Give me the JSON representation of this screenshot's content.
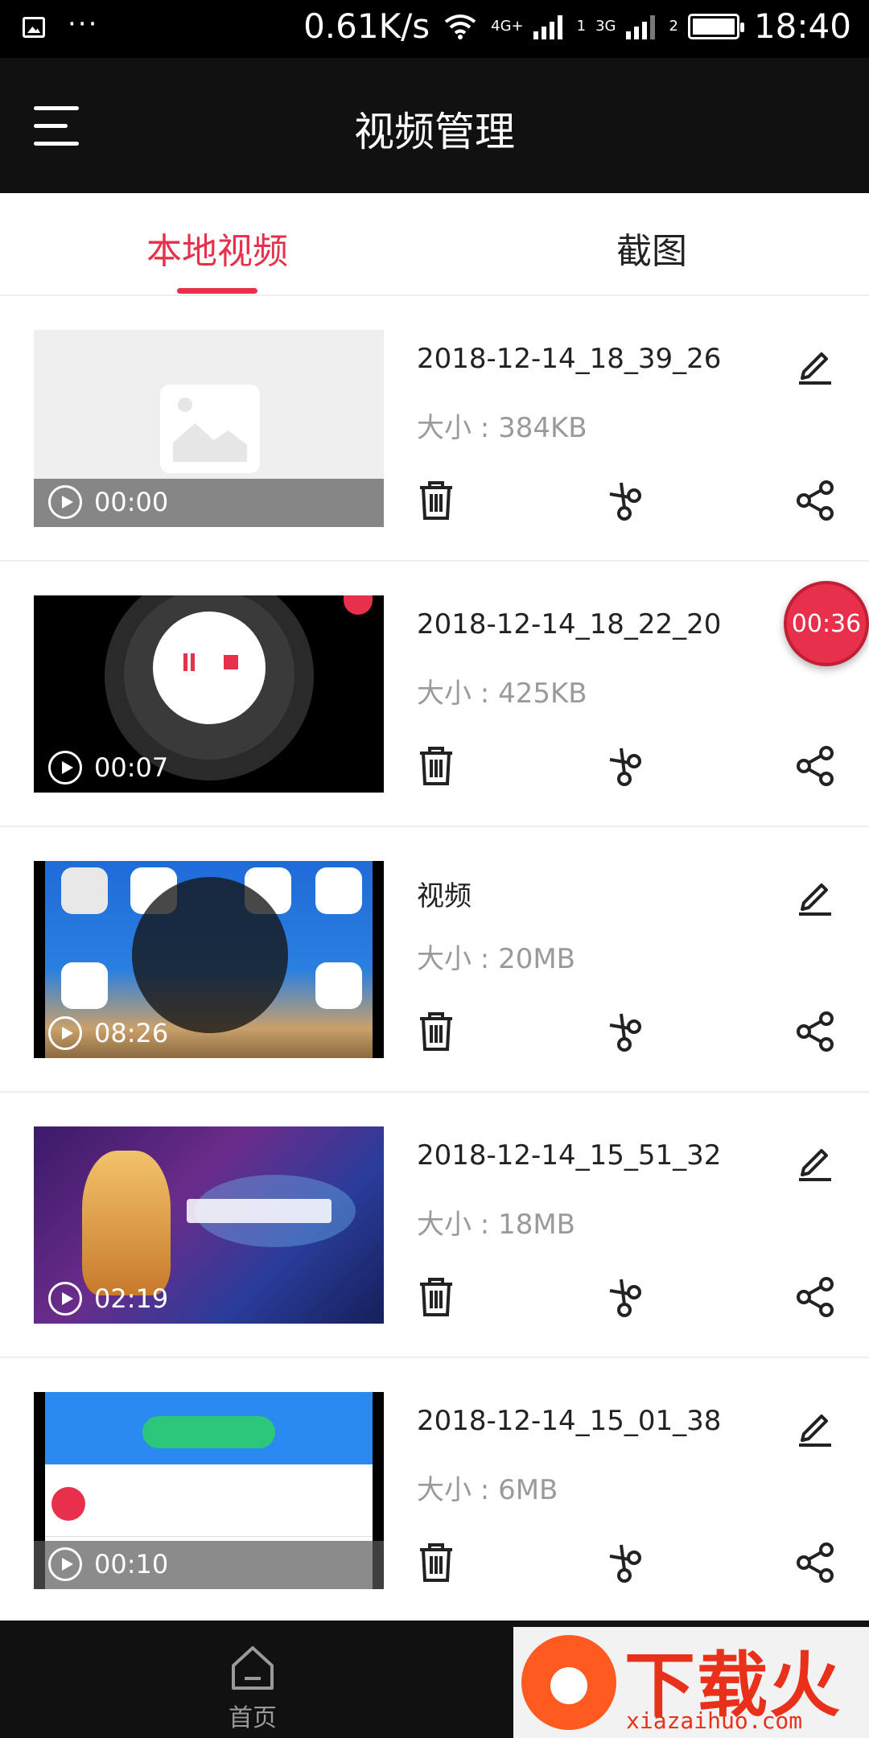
{
  "status_bar": {
    "net_speed": "0.61K/s",
    "sim1_label": "4G+",
    "sim1_slot": "1",
    "sim2_label": "3G",
    "sim2_slot": "2",
    "time": "18:40",
    "more": "···"
  },
  "app_bar": {
    "title": "视频管理"
  },
  "tabs": [
    {
      "label": "本地视频",
      "active": true
    },
    {
      "label": "截图",
      "active": false
    }
  ],
  "videos": [
    {
      "name": "2018-12-14_18_39_26",
      "size": "大小 : 384KB",
      "duration": "00:00"
    },
    {
      "name": "2018-12-14_18_22_20",
      "size": "大小 : 425KB",
      "duration": "00:07"
    },
    {
      "name": "视频",
      "size": "大小 : 20MB",
      "duration": "08:26"
    },
    {
      "name": "2018-12-14_15_51_32",
      "size": "大小 : 18MB",
      "duration": "02:19"
    },
    {
      "name": "2018-12-14_15_01_38",
      "size": "大小 : 6MB",
      "duration": "00:10"
    }
  ],
  "floating_timer": "00:36",
  "bottom_nav": {
    "home_label": "首页"
  },
  "watermark": {
    "brand": "下载火",
    "url": "xiazaihuo.com"
  },
  "colors": {
    "accent": "#e8304a",
    "bar": "#111111",
    "muted": "#9a9a9a"
  },
  "icons": [
    "menu-icon",
    "edit-icon",
    "trash-icon",
    "scissors-icon",
    "share-icon",
    "play-icon",
    "home-icon"
  ]
}
